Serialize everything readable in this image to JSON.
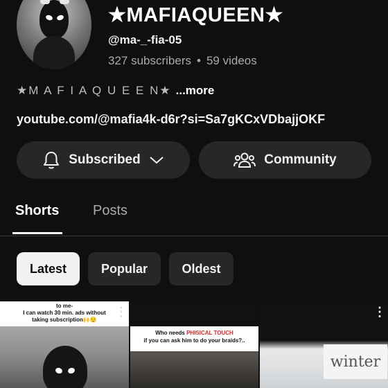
{
  "channel": {
    "title": "★MAFIAQUEEN★",
    "handle": "@ma-_-fia-05",
    "subscribers": "327 subscribers",
    "separator": "•",
    "videos": "59 videos",
    "description": "★M A F I A Q U E E N★",
    "more_label": "...more",
    "link": "youtube.com/@mafia4k-d6r?si=Sa7gKCxVDbajjOKF"
  },
  "actions": {
    "subscribed_label": "Subscribed",
    "community_label": "Community"
  },
  "tabs": [
    {
      "label": "Shorts",
      "active": true
    },
    {
      "label": "Posts",
      "active": false
    }
  ],
  "filters": [
    {
      "label": "Latest",
      "selected": true
    },
    {
      "label": "Popular",
      "selected": false
    },
    {
      "label": "Oldest",
      "selected": false
    }
  ],
  "shorts": [
    {
      "caption_lines": [
        "to me-",
        "I can watch 30 min. ads without",
        "taking subscription🙌😌"
      ]
    },
    {
      "caption_prefix": "Who needs ",
      "caption_highlight": "PHISICAL TOUCH",
      "caption_line2": "if you can ask him to do your braids?.."
    },
    {
      "overlay_text": "winter"
    }
  ],
  "icons": {
    "bell": "bell-icon",
    "chevron": "chevron-down-icon",
    "community": "people-icon",
    "more": "more-vert-icon"
  },
  "colors": {
    "background": "#0f0f0f",
    "pill": "#272727",
    "selected_chip": "#f1f1f1",
    "highlight_red": "#d6262c"
  }
}
